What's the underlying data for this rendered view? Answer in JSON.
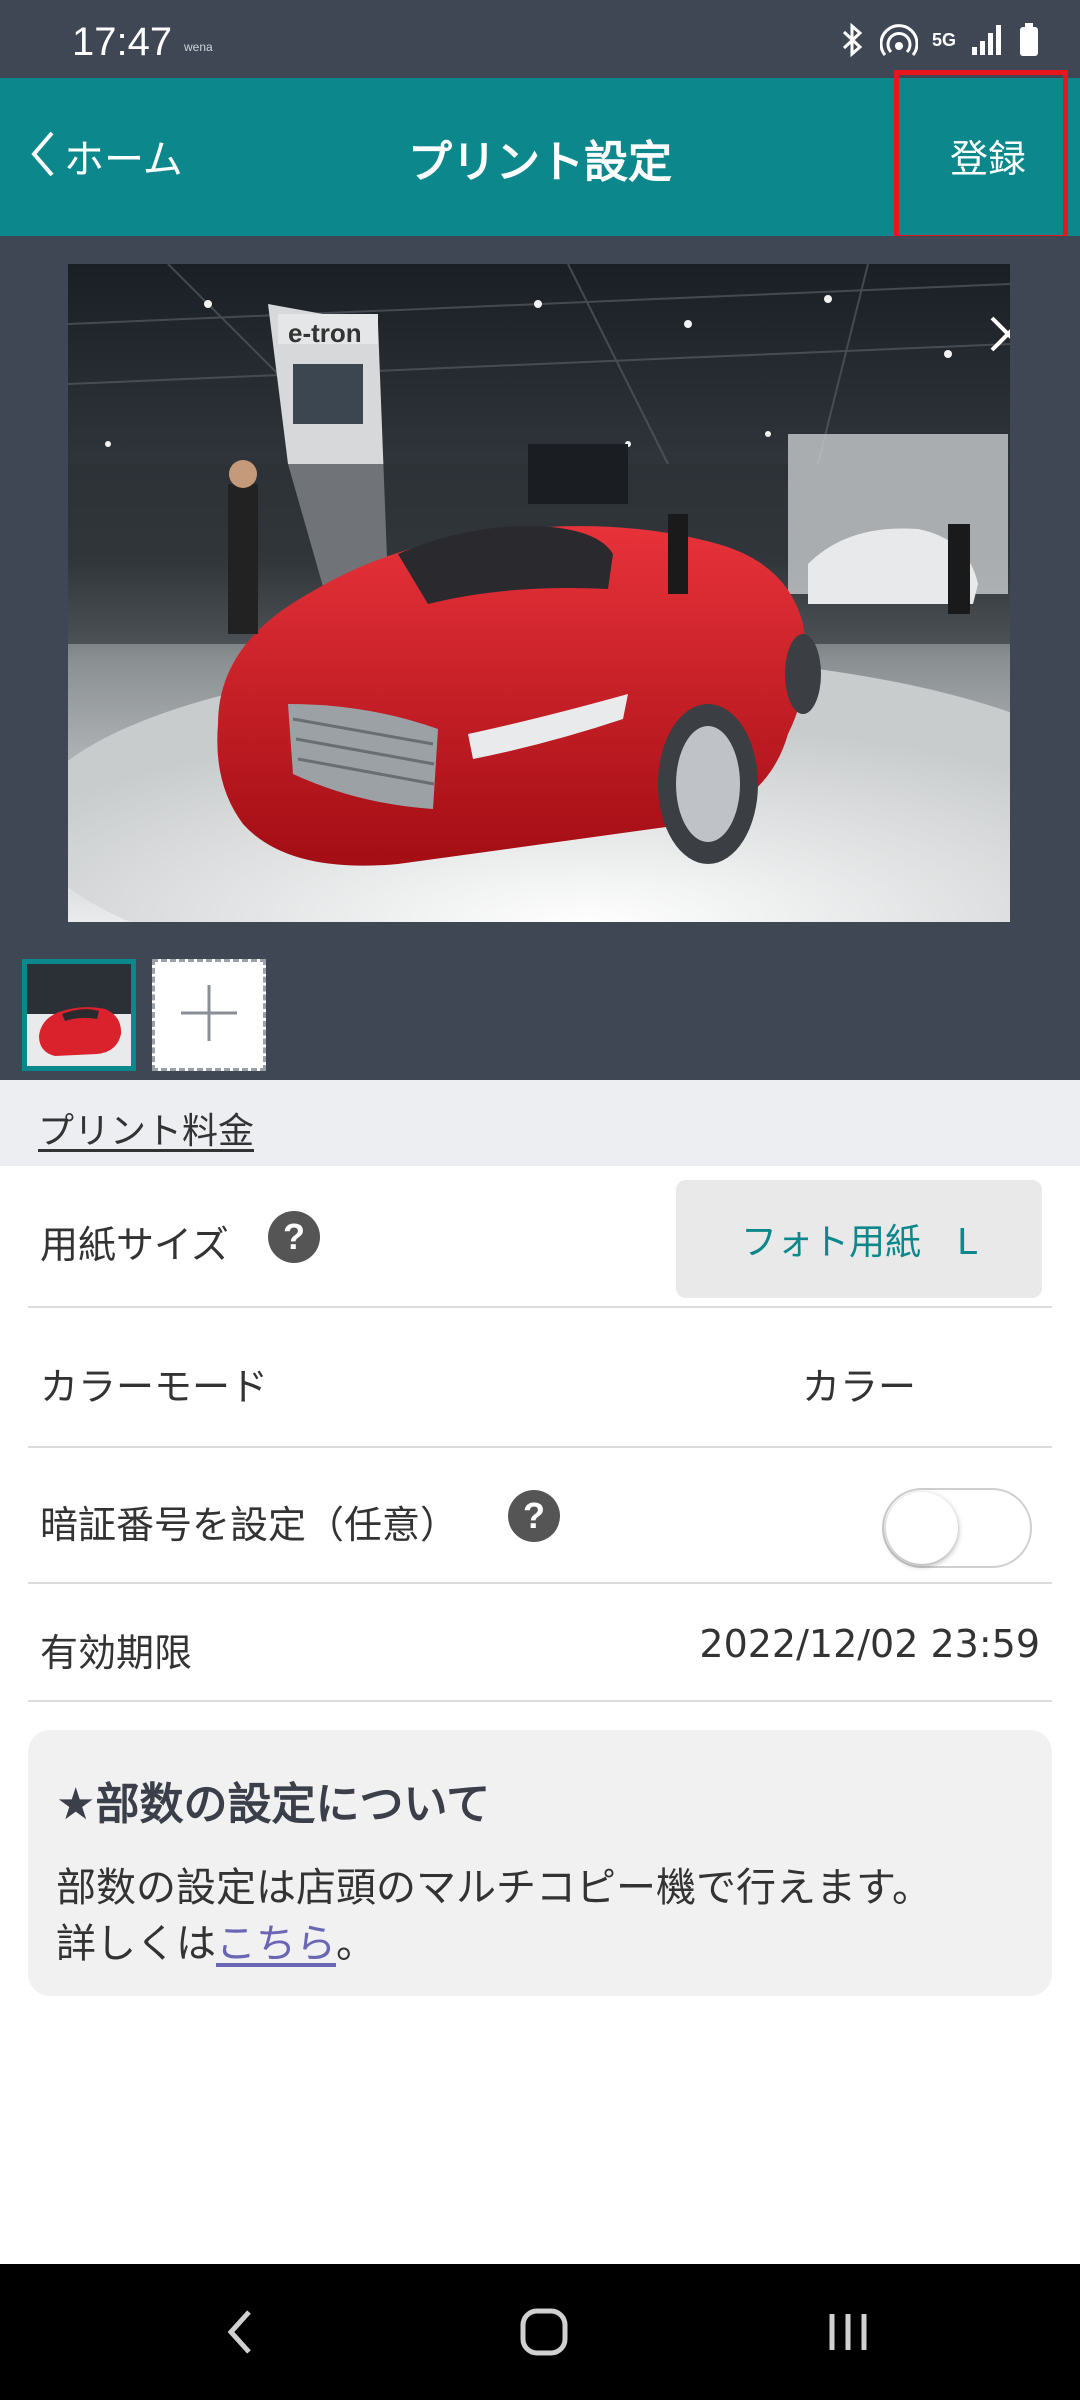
{
  "status_bar": {
    "time": "17:47",
    "carrier": "wena",
    "network": "5G",
    "icons": [
      "bluetooth-icon",
      "hotspot-icon",
      "5g-icon",
      "signal-icon",
      "battery-icon"
    ]
  },
  "header": {
    "back_label": "ホーム",
    "title": "プリント設定",
    "register_label": "登録",
    "background_color": "#0c888c"
  },
  "preview": {
    "image_description_icon": "red-sports-car-photo",
    "close_icon": "close-icon",
    "thumbnails": [
      {
        "selected": true
      },
      {
        "add": true
      }
    ]
  },
  "fee": {
    "label": "プリント料金"
  },
  "settings": {
    "paper_size": {
      "label": "用紙サイズ",
      "help": "?",
      "value": "フォト用紙　L"
    },
    "color_mode": {
      "label": "カラーモード",
      "value": "カラー"
    },
    "pin": {
      "label": "暗証番号を設定（任意）",
      "help": "?",
      "enabled": false
    },
    "expiry": {
      "label": "有効期限",
      "value": "2022/12/02 23:59"
    }
  },
  "info": {
    "title": "★部数の設定について",
    "body_line1": "部数の設定は店頭のマルチコピー機で行えます。",
    "body_line2_prefix": "詳しくは",
    "body_link": "こちら",
    "body_line2_suffix": "。"
  },
  "nav": {
    "buttons": [
      "back-icon",
      "home-icon",
      "recents-icon"
    ]
  }
}
